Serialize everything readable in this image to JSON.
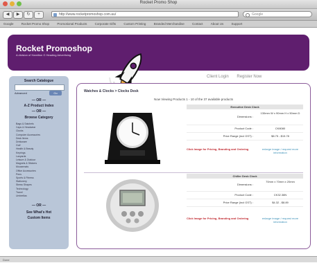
{
  "browser": {
    "window_title": "Rocket Promo Shop",
    "url": "http://www.rocketpromoshop.com.au/",
    "search_placeholder": "Google",
    "bookmarks": [
      "Google",
      "Rocket Promo Shop",
      "Promotional Products",
      "Corporate Gifts",
      "Custom Printing",
      "Branded Merchandise",
      "Contact",
      "About Us",
      "Support"
    ],
    "status": "Done"
  },
  "header": {
    "brand": "Rocket Promoshop",
    "tagline": "A division of Hamilton G Heading Advertising",
    "links": [
      "Client Login",
      "Register Now"
    ]
  },
  "sidebar": {
    "search_title": "Search Catalogue",
    "advanced_label": "Advanced",
    "go_label": "Go",
    "or1": "— OR —",
    "az_label": "A-Z Product Index",
    "or2": "— OR —",
    "browse_label": "Browse Category",
    "categories": [
      "Bags & Satchels",
      "Caps & Headwear",
      "Clocks",
      "Computer Accessories",
      "Desk Items",
      "Drinkware",
      "Golf",
      "Health & Beauty",
      "Keyrings",
      "Lanyards",
      "Leisure & Outdoor",
      "Magnets & Stickers",
      "Mousemats",
      "Office Accessories",
      "Pens",
      "Sports & Fitness",
      "Stationery",
      "Stress Shapes",
      "Technology",
      "Travel",
      "Umbrellas"
    ],
    "or3": "— OR —",
    "new_label": "See What's Hot",
    "new_label2": "Custom Items"
  },
  "content": {
    "breadcrumb": "Watches & Clocks > Clocks Desk",
    "viewing": "Now Viewing Products 1 - 10 of the 37 available products",
    "products": [
      {
        "title": "Executive Desk Clock",
        "dimensions_label": "Dimensions :",
        "dimensions_value": "130mm W x 90mm H x 50mm D",
        "code_label": "Product Code :",
        "code_value": "CK8080",
        "price_label": "Price Range (incl GST) :",
        "price_value": "$8.75 - $15.78",
        "request_label": "Click Image for Pricing, Branding and Ordering",
        "enlarge": "enlarge image / request more information"
      },
      {
        "title": "Chiller Desk Clock",
        "dimensions_label": "Dimensions :",
        "dimensions_value": "70mm x 70mm x 20mm",
        "code_label": "Product Code :",
        "code_value": "CK32.38N",
        "price_label": "Price Range (incl GST) :",
        "price_value": "$4.32 - $8.89",
        "request_label": "Click Image for Pricing, Branding and Ordering",
        "enlarge": "enlarge image / request more information"
      }
    ]
  },
  "colors": {
    "header_bg": "#5f1e6e",
    "sidebar_bg": "#b9c6d8",
    "accent_red": "#c0282f",
    "link_blue": "#3a8fb7"
  }
}
